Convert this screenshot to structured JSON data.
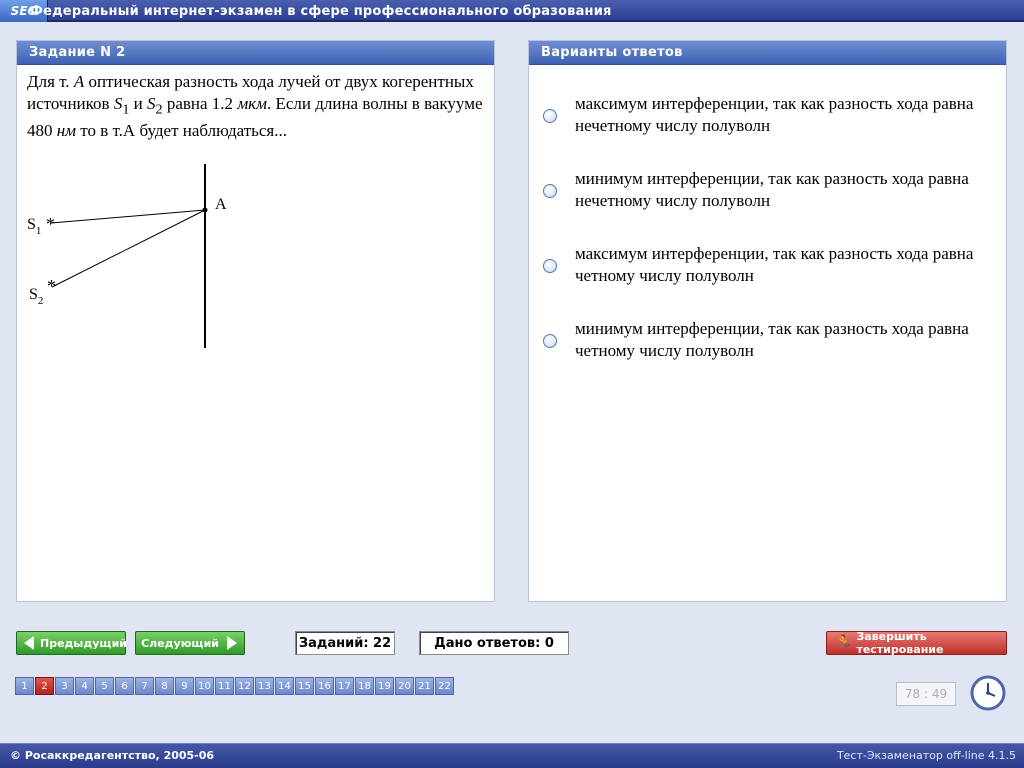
{
  "window": {
    "logo": "SEC",
    "title": "Федеральный интернет-экзамен в сфере профессионального образования"
  },
  "task": {
    "header": "Задание N 2",
    "question": {
      "p1": "Для т. ",
      "A": "A",
      "p2": " оптическая разность хода лучей от двух когерентных источников ",
      "S1": "S",
      "S1sub": "1",
      "and": " и ",
      "S2": "S",
      "S2sub": "2",
      "p3": " равна 1.2 ",
      "unit1": "мкм",
      "p4": ". Если длина волны  в вакууме 480 ",
      "unit2": "нм",
      "p5": " то в т.А будет наблюдаться..."
    },
    "figure": {
      "label_a": "A",
      "label_s": "S",
      "label_s1_sub": "1",
      "label_s2_sub": "2",
      "star": "*"
    }
  },
  "answers": {
    "header": "Варианты ответов",
    "options": [
      {
        "text": "максимум интерференции, так как разность хода равна нечетному числу полуволн"
      },
      {
        "text": "минимум интерференции, так как разность хода равна нечетному числу полуволн"
      },
      {
        "text": "максимум интерференции, так как разность хода равна четному числу полуволн"
      },
      {
        "text": "минимум интерференции, так как разность хода равна четному числу полуволн"
      }
    ]
  },
  "nav": {
    "prev_label": "Предыдущий",
    "next_label": "Следующий",
    "tasks_count": "Заданий: 22",
    "answers_count": "Дано ответов: 0",
    "finish_label": "Завершить тестирование",
    "pages": [
      "1",
      "2",
      "3",
      "4",
      "5",
      "6",
      "7",
      "8",
      "9",
      "10",
      "11",
      "12",
      "13",
      "14",
      "15",
      "16",
      "17",
      "18",
      "19",
      "20",
      "21",
      "22"
    ],
    "current_page": "2",
    "timer": "78 : 49"
  },
  "footer": {
    "copyright": "© Росаккредагентство, 2005-06",
    "version": "Тест-Экзаменатор off-line 4.1.5"
  },
  "colors": {
    "title_bar": "#2d3f92",
    "panel_header": "#4f70bd",
    "nav_green": "#2f9a2a",
    "finish_red": "#c0302c",
    "page_active": "#b4221c"
  },
  "icons": {
    "prev": "arrow-left-icon",
    "next": "arrow-right-icon",
    "finish": "running-man-icon",
    "timer": "clock-icon",
    "answer": "radio-icon"
  }
}
